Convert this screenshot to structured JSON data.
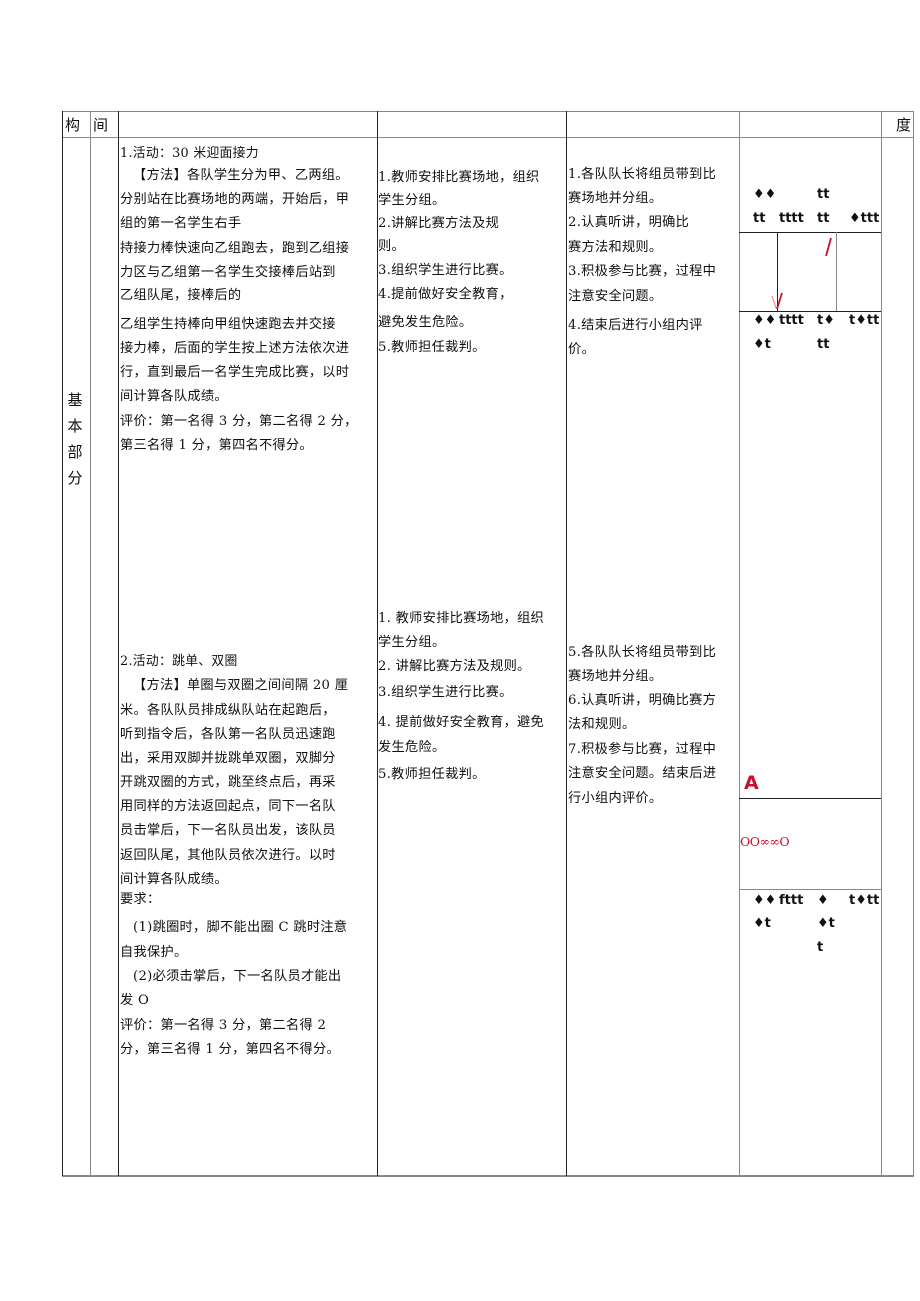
{
  "header": {
    "col1": "构",
    "col2": "间",
    "col_last": "度"
  },
  "section_label": [
    "基",
    "本",
    "部",
    "分"
  ],
  "activity1": {
    "content": [
      "1.活动：30 米迎面接力",
      "【方法】各队学生分为甲、乙两组。",
      "分别站在比赛场地的两端，开始后，甲",
      "组的第一名学生右手",
      "持接力棒快速向乙组跑去，跑到乙组接",
      "力区与乙组第一名学生交接棒后站到",
      "乙组队尾，接棒后的",
      "乙组学生持棒向甲组快速跑去并交接",
      "接力棒，后面的学生按上述方法依次进",
      "行，直到最后一名学生完成比赛，以时",
      "间计算各队成绩。",
      "评价：第一名得 3 分，第二名得 2 分，",
      "第三名得 1 分，第四名不得分。"
    ],
    "teacher": [
      "1.教师安排比赛场地，组织",
      "学生分组。",
      "2.讲解比赛方法及规",
      "则。",
      "3.组织学生进行比赛。",
      "4.提前做好安全教育，",
      "避免发生危险。",
      "5.教师担任裁判。"
    ],
    "student": [
      "1.各队队长将组员带到比",
      "赛场地并分组。",
      "2.认真听讲，明确比",
      "赛方法和规则。",
      "3.积极参与比赛，过程中",
      "注意安全问题。",
      "4.结束后进行小组内评",
      "价。"
    ],
    "formation_top": {
      "row1": [
        "♦♦",
        "",
        "tt",
        ""
      ],
      "row2": [
        "tt",
        "tttt",
        "tt",
        "♦ttt"
      ]
    },
    "formation_bottom": {
      "row1": [
        "♦♦",
        "tttt",
        "t♦",
        "t♦tt"
      ],
      "row2": [
        "♦t",
        "",
        "tt",
        ""
      ]
    },
    "marks": [
      "/",
      "\\/"
    ]
  },
  "activity2": {
    "content": [
      "2.活动：跳单、双圈",
      "【方法】单圈与双圈之间间隔 20 厘",
      "米。各队队员排成纵队站在起跑后，",
      "听到指令后，各队第一名队员迅速跑",
      "出，采用双脚并拢跳单双圈，双脚分",
      "开跳双圈的方式，跳至终点后，再采",
      "用同样的方法返回起点，同下一名队",
      "员击掌后，下一名队员出发，该队员",
      "返回队尾，其他队员依次进行。以时",
      "间计算各队成绩。",
      "要求：",
      "(1)跳圈时，脚不能出圈 C 跳时注意",
      "自我保护。",
      "(2)必须击掌后，下一名队员才能出",
      "发 O",
      "评价：第一名得 3 分，第二名得 2",
      "分，第三名得 1 分，第四名不得分。"
    ],
    "teacher": [
      "1. 教师安排比赛场地，组织",
      "学生分组。",
      "2. 讲解比赛方法及规则。",
      "3.组织学生进行比赛。",
      "4. 提前做好安全教育，避免",
      "发生危险。",
      "5.教师担任裁判。"
    ],
    "student": [
      "5.各队队长将组员带到比",
      "赛场地并分组。",
      "6.认真听讲，明确比赛方",
      "法和规则。",
      "7.积极参与比赛，过程中",
      "注意安全问题。结束后进",
      "行小组内评价。"
    ],
    "marker_a": "A",
    "circles": "OO∞∞O",
    "formation": {
      "row1": [
        "♦♦",
        "fttt",
        "♦",
        "t♦tt"
      ],
      "row2": [
        "♦t",
        "",
        "♦t",
        ""
      ],
      "row3": [
        "",
        "",
        "t",
        ""
      ]
    }
  }
}
